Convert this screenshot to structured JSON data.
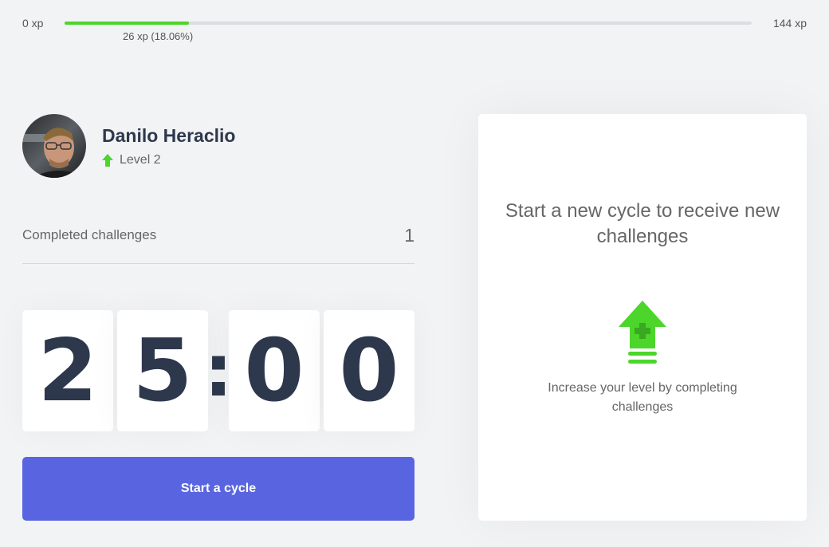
{
  "xp": {
    "min_label": "0 xp",
    "max_label": "144 xp",
    "current_label": "26 xp (18.06%)",
    "progress_percent": 18.06,
    "bar_color": "#4cd62b"
  },
  "profile": {
    "name": "Danilo Heraclio",
    "level_label": "Level 2",
    "level_icon": "level-up-arrow-icon"
  },
  "challenges": {
    "label": "Completed challenges",
    "count": "1"
  },
  "countdown": {
    "minute_left": "2",
    "minute_right": "5",
    "separator": ":",
    "second_left": "0",
    "second_right": "0"
  },
  "button": {
    "label": "Start a cycle",
    "color": "#5965e0"
  },
  "card": {
    "title": "Start a new cycle to receive new challenges",
    "icon": "level-up-icon",
    "text": "Increase your level by completing challenges"
  },
  "colors": {
    "background": "#f2f3f5",
    "title_text": "#2e384d",
    "accent_green": "#4cd62b"
  }
}
